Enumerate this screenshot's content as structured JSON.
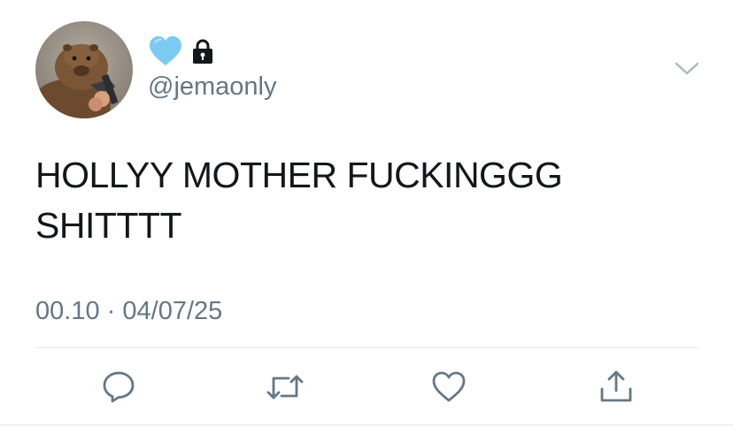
{
  "user": {
    "handle": "@jemaonly",
    "display_name_icons": [
      "light-blue-heart-emoji",
      "lock-icon"
    ],
    "avatar": "capybara-with-gun-avatar"
  },
  "tweet": {
    "text_lines": [
      "HOLLYY MOTHER FUCKINGGG",
      "SHITTTT"
    ],
    "time": "00.10",
    "separator": "·",
    "date": "04/07/25"
  },
  "actions": [
    {
      "name": "reply",
      "icon": "speech-bubble-icon"
    },
    {
      "name": "retweet",
      "icon": "retweet-icon"
    },
    {
      "name": "like",
      "icon": "heart-outline-icon"
    },
    {
      "name": "share",
      "icon": "share-upload-icon"
    }
  ],
  "colors": {
    "text": "#14171a",
    "secondary_text": "#657786",
    "icon_gray": "#657786",
    "heart_emoji": "#7ccaf2",
    "divider": "#e1e8ed"
  }
}
